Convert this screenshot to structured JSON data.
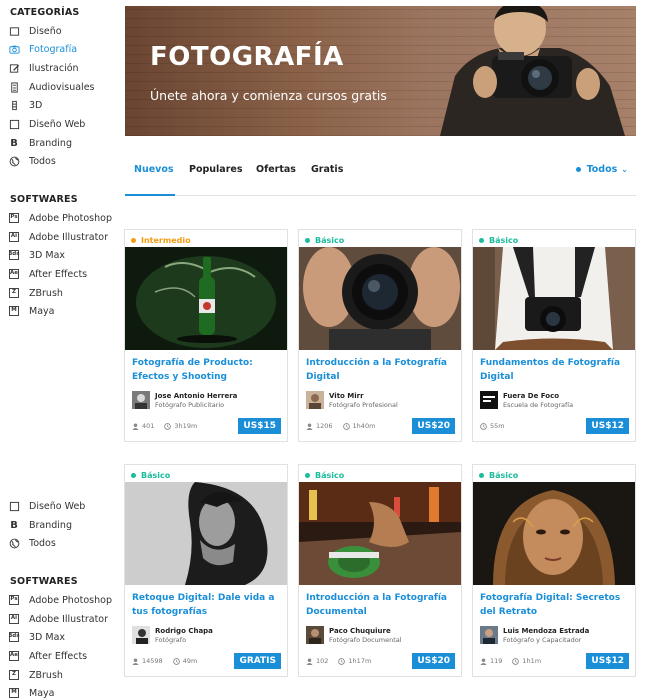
{
  "sidebar": {
    "categories_title": "CATEGORÍAS",
    "categories": [
      {
        "label": "Diseño",
        "icon": "square-icon"
      },
      {
        "label": "Fotografía",
        "icon": "camera-icon",
        "active": true
      },
      {
        "label": "Ilustración",
        "icon": "pencil-icon"
      },
      {
        "label": "Audiovisuales",
        "icon": "film-icon"
      },
      {
        "label": "3D",
        "icon": "cube-icon"
      },
      {
        "label": "Diseño Web",
        "icon": "square-icon"
      },
      {
        "label": "Branding",
        "icon": "b-icon"
      },
      {
        "label": "Todos",
        "icon": "globe-icon"
      }
    ],
    "softwares_title": "SOFTWARES",
    "softwares": [
      {
        "label": "Adobe Photoshop",
        "icon_text": "Ps"
      },
      {
        "label": "Adobe Illustrator",
        "icon_text": "Ai"
      },
      {
        "label": "3D Max",
        "icon_text": "3ds"
      },
      {
        "label": "After Effects",
        "icon_text": "Ae"
      },
      {
        "label": "ZBrush",
        "icon_text": "Z"
      },
      {
        "label": "Maya",
        "icon_text": "M"
      }
    ],
    "repeat_categories": [
      {
        "label": "Diseño Web",
        "icon": "square-icon"
      },
      {
        "label": "Branding",
        "icon": "b-icon"
      },
      {
        "label": "Todos",
        "icon": "globe-icon"
      }
    ],
    "repeat_softwares_title": "SOFTWARES",
    "repeat_softwares": [
      {
        "label": "Adobe Photoshop",
        "icon_text": "Ps"
      },
      {
        "label": "Adobe Illustrator",
        "icon_text": "Ai"
      },
      {
        "label": "3D Max",
        "icon_text": "3ds"
      },
      {
        "label": "After Effects",
        "icon_text": "Ae"
      },
      {
        "label": "ZBrush",
        "icon_text": "Z"
      },
      {
        "label": "Maya",
        "icon_text": "M"
      }
    ]
  },
  "banner": {
    "title": "FOTOGRAFÍA",
    "subtitle": "Únete ahora y comienza cursos gratis"
  },
  "tabs": {
    "items": [
      "Nuevos",
      "Populares",
      "Ofertas",
      "Gratis"
    ],
    "active": "Nuevos",
    "filter_label": "Todos"
  },
  "colors": {
    "accent": "#1a8fd8",
    "intermedio": "#f39c12",
    "basico": "#1abc9c"
  },
  "courses": [
    {
      "level": "Intermedio",
      "title": "Fotografía de Producto: Efectos y Shooting",
      "author": "Jose Antonio Herrera",
      "role": "Fotógrafo Publicitario",
      "students": "401",
      "duration": "3h19m",
      "price": "US$15"
    },
    {
      "level": "Básico",
      "title": "Introducción a la Fotografía Digital",
      "author": "Vito Mirr",
      "role": "Fotógrafo Profesional",
      "students": "1206",
      "duration": "1h40m",
      "price": "US$20"
    },
    {
      "level": "Básico",
      "title": "Fundamentos de Fotografía Digital",
      "author": "Fuera De Foco",
      "role": "Escuela de Fotografía",
      "students": "",
      "duration": "55m",
      "price": "US$12"
    },
    {
      "level": "Básico",
      "title": "Retoque Digital: Dale vida a tus fotografías",
      "author": "Rodrigo Chapa",
      "role": "Fotógrafo",
      "students": "14598",
      "duration": "49m",
      "price": "GRATIS"
    },
    {
      "level": "Básico",
      "title": "Introducción a la Fotografía Documental",
      "author": "Paco Chuquiure",
      "role": "Fotógrafo Documental",
      "students": "102",
      "duration": "1h17m",
      "price": "US$20"
    },
    {
      "level": "Básico",
      "title": "Fotografía Digital: Secretos del Retrato",
      "author": "Luis Mendoza Estrada",
      "role": "Fotógrafo y Capacitador",
      "students": "119",
      "duration": "1h1m",
      "price": "US$12"
    }
  ],
  "avatar_logo_text": "FUERA DE FOCO"
}
